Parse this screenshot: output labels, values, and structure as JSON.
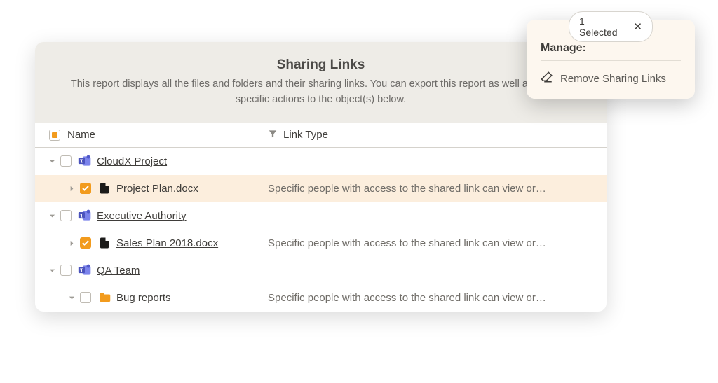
{
  "header": {
    "title": "Sharing Links",
    "description": "This report displays all the files and folders and their sharing links. You can export this report as well as perform specific actions to the object(s) below."
  },
  "columns": {
    "name": "Name",
    "link_type": "Link Type"
  },
  "rows": [
    {
      "depth": 0,
      "expanded": true,
      "checked": false,
      "icon": "teams",
      "name": "CloudX Project",
      "link_type": "",
      "selected": false
    },
    {
      "depth": 1,
      "expanded": false,
      "chev": "right",
      "checked": true,
      "icon": "file",
      "name": "Project Plan.docx",
      "link_type": "Specific people with access to the shared link can view or…",
      "selected": true
    },
    {
      "depth": 0,
      "expanded": true,
      "checked": false,
      "icon": "teams",
      "name": "Executive Authority",
      "link_type": "",
      "selected": false
    },
    {
      "depth": 1,
      "expanded": false,
      "chev": "right",
      "checked": true,
      "icon": "file",
      "name": "Sales Plan 2018.docx",
      "link_type": "Specific people with access to the shared link can view or…",
      "selected": false
    },
    {
      "depth": 0,
      "expanded": true,
      "checked": false,
      "icon": "teams",
      "name": "QA Team",
      "link_type": "",
      "selected": false
    },
    {
      "depth": 1,
      "expanded": true,
      "checked": false,
      "icon": "folder",
      "name": "Bug reports",
      "link_type": "Specific people with access to the shared link can view or…",
      "selected": false
    }
  ],
  "popover": {
    "selected_label": "1 Selected",
    "manage_label": "Manage:",
    "action_label": "Remove Sharing Links"
  }
}
